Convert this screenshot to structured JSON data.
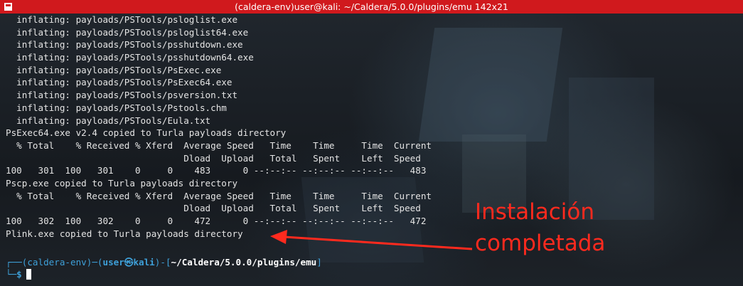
{
  "window": {
    "title": "(caldera-env)user@kali: ~/Caldera/5.0.0/plugins/emu 142x21"
  },
  "terminal": {
    "lines": [
      "  inflating: payloads/PSTools/psloglist.exe",
      "  inflating: payloads/PSTools/psloglist64.exe",
      "  inflating: payloads/PSTools/psshutdown.exe",
      "  inflating: payloads/PSTools/psshutdown64.exe",
      "  inflating: payloads/PSTools/PsExec.exe",
      "  inflating: payloads/PSTools/PsExec64.exe",
      "  inflating: payloads/PSTools/psversion.txt",
      "  inflating: payloads/PSTools/Pstools.chm",
      "  inflating: payloads/PSTools/Eula.txt",
      "PsExec64.exe v2.4 copied to Turla payloads directory",
      "  % Total    % Received % Xferd  Average Speed   Time    Time     Time  Current",
      "                                 Dload  Upload   Total   Spent    Left  Speed",
      "100   301  100   301    0     0    483      0 --:--:-- --:--:-- --:--:--   483",
      "Pscp.exe copied to Turla payloads directory",
      "  % Total    % Received % Xferd  Average Speed   Time    Time     Time  Current",
      "                                 Dload  Upload   Total   Spent    Left  Speed",
      "100   302  100   302    0     0    472      0 --:--:-- --:--:-- --:--:--   472",
      "Plink.exe copied to Turla payloads directory"
    ],
    "prompt": {
      "corner_top": "┌──",
      "env": "(caldera-env)",
      "dash1": "─(",
      "user": "user",
      "at_symbol": "㉿",
      "host": "kali",
      "dash2": ")-[",
      "path": "~/Caldera/5.0.0/plugins/emu",
      "close": "]",
      "corner_bottom": "└─",
      "symbol": "$"
    }
  },
  "annotation": {
    "text": "Instalación\ncompletada",
    "color": "#ff2a1e"
  }
}
